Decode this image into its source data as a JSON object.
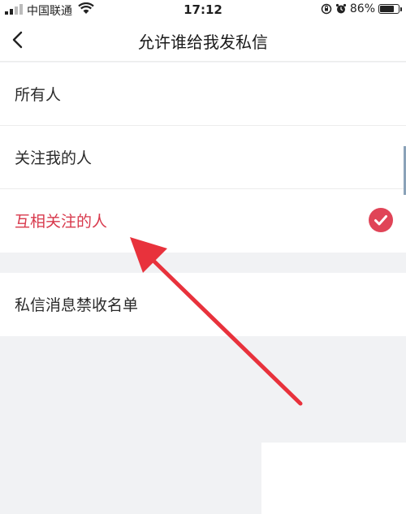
{
  "status_bar": {
    "carrier": "中国联通",
    "time": "17:12",
    "battery_percent": "86%",
    "battery_level": 0.86,
    "icons": [
      "signal-icon",
      "wifi-icon",
      "rotation-lock-icon",
      "alarm-icon",
      "battery-icon"
    ]
  },
  "nav": {
    "back_icon": "back-chevron-icon",
    "title": "允许谁给我发私信"
  },
  "options": [
    {
      "label": "所有人",
      "selected": false
    },
    {
      "label": "关注我的人",
      "selected": false
    },
    {
      "label": "互相关注的人",
      "selected": true
    }
  ],
  "blacklist": {
    "label": "私信消息禁收名单"
  },
  "annotation": {
    "type": "arrow",
    "color": "#e8323c",
    "points_to": "互相关注的人"
  },
  "colors": {
    "accent": "#e04457",
    "selected_text": "#d8394c",
    "background": "#f1f2f4"
  }
}
